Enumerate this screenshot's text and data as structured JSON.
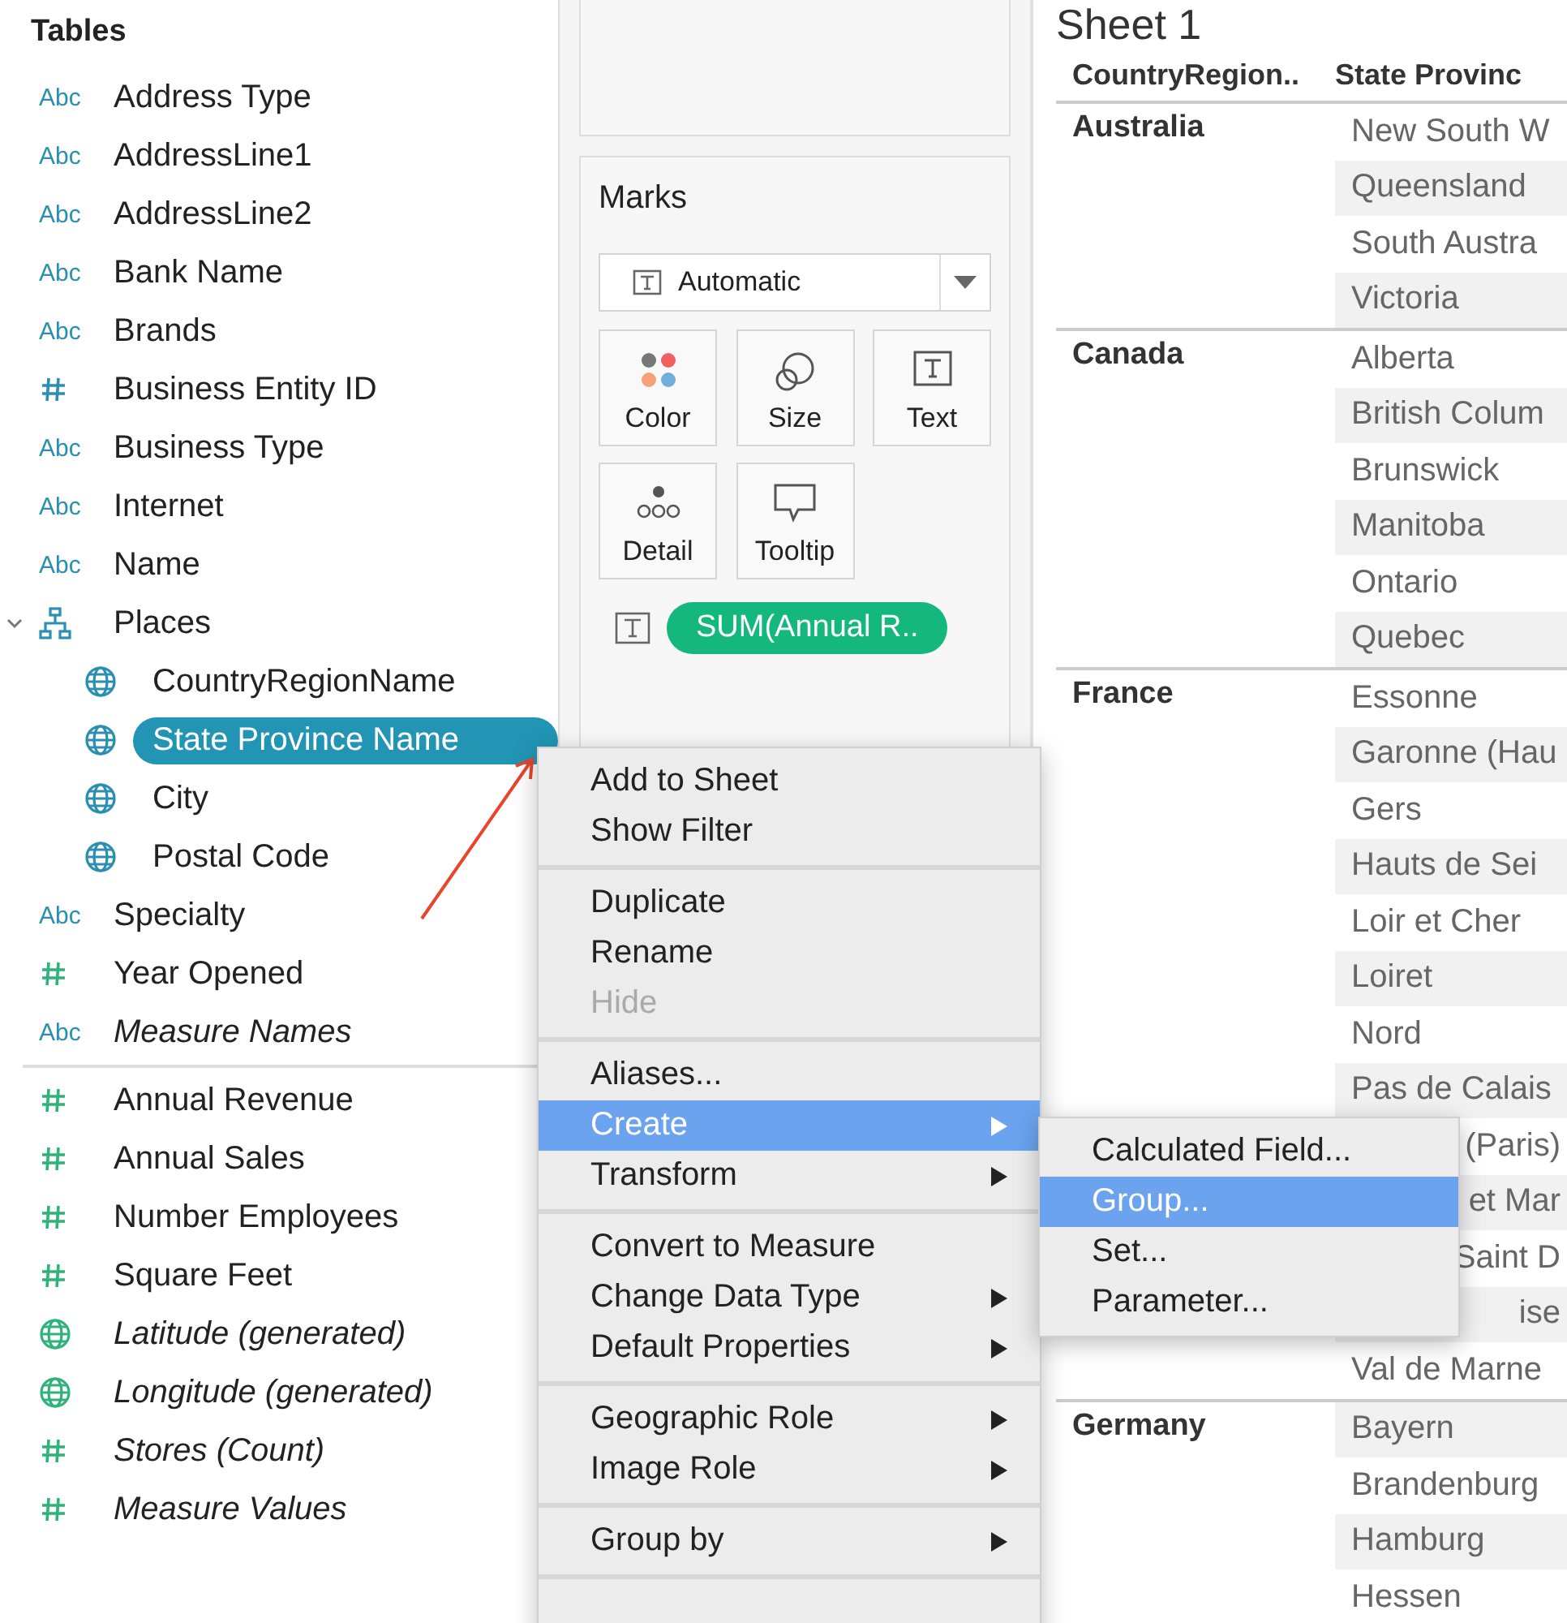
{
  "sidebar": {
    "title": "Tables",
    "fields": [
      {
        "name": "Address Type",
        "kind": "string",
        "badge": "Abc",
        "color": "#2a8fb0",
        "italic": false,
        "selected": false
      },
      {
        "name": "AddressLine1",
        "kind": "string",
        "badge": "Abc",
        "color": "#2a8fb0",
        "italic": false,
        "selected": false
      },
      {
        "name": "AddressLine2",
        "kind": "string",
        "badge": "Abc",
        "color": "#2a8fb0",
        "italic": false,
        "selected": false
      },
      {
        "name": "Bank Name",
        "kind": "string",
        "badge": "Abc",
        "color": "#2a8fb0",
        "italic": false,
        "selected": false
      },
      {
        "name": "Brands",
        "kind": "string",
        "badge": "Abc",
        "color": "#2a8fb0",
        "italic": false,
        "selected": false
      },
      {
        "name": "Business Entity ID",
        "kind": "number",
        "color": "#2a8fb0",
        "italic": false,
        "selected": false
      },
      {
        "name": "Business Type",
        "kind": "string",
        "badge": "Abc",
        "color": "#2a8fb0",
        "italic": false,
        "selected": false
      },
      {
        "name": "Internet",
        "kind": "string",
        "badge": "Abc",
        "color": "#2a8fb0",
        "italic": false,
        "selected": false
      },
      {
        "name": "Name",
        "kind": "string",
        "badge": "Abc",
        "color": "#2a8fb0",
        "italic": false,
        "selected": false
      },
      {
        "name": "Places",
        "kind": "hierarchy",
        "color": "#2a8fb0",
        "italic": false,
        "selected": false,
        "expanded": true,
        "children": [
          {
            "name": "CountryRegionName",
            "kind": "geo",
            "color": "#2a8fb0",
            "italic": false,
            "selected": false
          },
          {
            "name": "State Province Name",
            "kind": "geo",
            "color": "#2a8fb0",
            "italic": false,
            "selected": true
          },
          {
            "name": "City",
            "kind": "geo",
            "color": "#2a8fb0",
            "italic": false,
            "selected": false
          },
          {
            "name": "Postal Code",
            "kind": "geo",
            "color": "#2a8fb0",
            "italic": false,
            "selected": false
          }
        ]
      },
      {
        "name": "Specialty",
        "kind": "string",
        "badge": "Abc",
        "color": "#2a8fb0",
        "italic": false,
        "selected": false
      },
      {
        "name": "Year Opened",
        "kind": "number",
        "color": "#2fb37a",
        "italic": false,
        "selected": false
      },
      {
        "name": "Measure Names",
        "kind": "string",
        "badge": "Abc",
        "color": "#2a8fb0",
        "italic": true,
        "selected": false
      }
    ],
    "measures": [
      {
        "name": "Annual Revenue",
        "kind": "number",
        "color": "#2fb37a",
        "italic": false,
        "selected": false
      },
      {
        "name": "Annual Sales",
        "kind": "number",
        "color": "#2fb37a",
        "italic": false,
        "selected": false
      },
      {
        "name": "Number Employees",
        "kind": "number",
        "color": "#2fb37a",
        "italic": false,
        "selected": false
      },
      {
        "name": "Square Feet",
        "kind": "number",
        "color": "#2fb37a",
        "italic": false,
        "selected": false
      },
      {
        "name": "Latitude (generated)",
        "kind": "geo",
        "color": "#2fb37a",
        "italic": true,
        "selected": false
      },
      {
        "name": "Longitude (generated)",
        "kind": "geo",
        "color": "#2fb37a",
        "italic": true,
        "selected": false
      },
      {
        "name": "Stores (Count)",
        "kind": "number",
        "color": "#2fb37a",
        "italic": true,
        "selected": false
      },
      {
        "name": "Measure Values",
        "kind": "number",
        "color": "#2fb37a",
        "italic": true,
        "selected": false
      }
    ]
  },
  "marks": {
    "title": "Marks",
    "mark_type": "Automatic",
    "buttons": [
      {
        "label": "Color",
        "kind": "color"
      },
      {
        "label": "Size",
        "kind": "size"
      },
      {
        "label": "Text",
        "kind": "text"
      },
      {
        "label": "Detail",
        "kind": "detail"
      },
      {
        "label": "Tooltip",
        "kind": "tooltip"
      }
    ],
    "pill": "SUM(Annual R.."
  },
  "sheet": {
    "title": "Sheet 1",
    "columns": [
      "CountryRegion..",
      "State Provinc"
    ],
    "groups": [
      {
        "country": "Australia",
        "states": [
          {
            "name": "New South W",
            "covered": false
          },
          {
            "name": "Queensland",
            "covered": false
          },
          {
            "name": "South Austra",
            "covered": false
          },
          {
            "name": "Victoria",
            "covered": false
          }
        ]
      },
      {
        "country": "Canada",
        "states": [
          {
            "name": "Alberta",
            "covered": false
          },
          {
            "name": "British Colum",
            "covered": false
          },
          {
            "name": "Brunswick",
            "covered": false
          },
          {
            "name": "Manitoba",
            "covered": false
          },
          {
            "name": "Ontario",
            "covered": false
          },
          {
            "name": "Quebec",
            "covered": false
          }
        ]
      },
      {
        "country": "France",
        "states": [
          {
            "name": "Essonne",
            "covered": false
          },
          {
            "name": "Garonne (Hau",
            "covered": false
          },
          {
            "name": "Gers",
            "covered": false
          },
          {
            "name": "Hauts de Sei",
            "covered": false
          },
          {
            "name": "Loir et Cher",
            "covered": false
          },
          {
            "name": "Loiret",
            "covered": false
          },
          {
            "name": "Nord",
            "covered": false
          },
          {
            "name": "Pas de Calais",
            "covered": false
          },
          {
            "name": "(Paris)",
            "covered": true
          },
          {
            "name": "et Mar",
            "covered": true
          },
          {
            "name": "Saint D",
            "covered": true
          },
          {
            "name": "ise",
            "covered": true
          },
          {
            "name": "Val de Marne",
            "covered": false
          }
        ]
      },
      {
        "country": "Germany",
        "states": [
          {
            "name": "Bayern",
            "covered": false
          },
          {
            "name": "Brandenburg",
            "covered": false
          },
          {
            "name": "Hamburg",
            "covered": false
          },
          {
            "name": "Hessen",
            "covered": false
          }
        ]
      }
    ]
  },
  "context_menu": {
    "groups": [
      [
        {
          "label": "Add to Sheet",
          "submenu": false,
          "disabled": false,
          "selected": false
        },
        {
          "label": "Show Filter",
          "submenu": false,
          "disabled": false,
          "selected": false
        }
      ],
      [
        {
          "label": "Duplicate",
          "submenu": false,
          "disabled": false,
          "selected": false
        },
        {
          "label": "Rename",
          "submenu": false,
          "disabled": false,
          "selected": false
        },
        {
          "label": "Hide",
          "submenu": false,
          "disabled": true,
          "selected": false
        }
      ],
      [
        {
          "label": "Aliases...",
          "submenu": false,
          "disabled": false,
          "selected": false
        },
        {
          "label": "Create",
          "submenu": true,
          "disabled": false,
          "selected": true
        },
        {
          "label": "Transform",
          "submenu": true,
          "disabled": false,
          "selected": false
        }
      ],
      [
        {
          "label": "Convert to Measure",
          "submenu": false,
          "disabled": false,
          "selected": false
        },
        {
          "label": "Change Data Type",
          "submenu": true,
          "disabled": false,
          "selected": false
        },
        {
          "label": "Default Properties",
          "submenu": true,
          "disabled": false,
          "selected": false
        }
      ],
      [
        {
          "label": "Geographic Role",
          "submenu": true,
          "disabled": false,
          "selected": false
        },
        {
          "label": "Image Role",
          "submenu": true,
          "disabled": false,
          "selected": false
        }
      ],
      [
        {
          "label": "Group by",
          "submenu": true,
          "disabled": false,
          "selected": false
        }
      ]
    ],
    "submenu": [
      {
        "label": "Calculated Field...",
        "selected": false
      },
      {
        "label": "Group...",
        "selected": true
      },
      {
        "label": "Set...",
        "selected": false
      },
      {
        "label": "Parameter...",
        "selected": false
      }
    ]
  }
}
